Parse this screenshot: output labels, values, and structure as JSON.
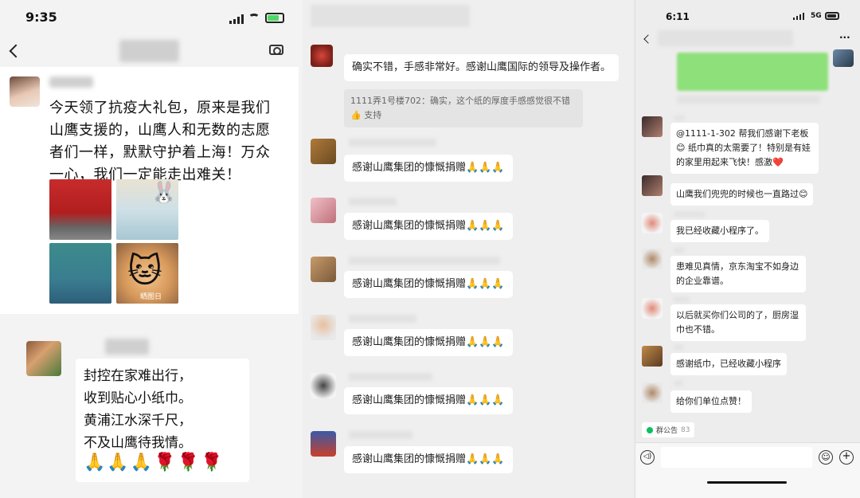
{
  "left": {
    "time": "9:35",
    "post_lines": [
      "今天领了抗疫大礼包，原来是我们",
      "山鹰支援的，山鹰人和无数的志愿",
      "者们一样，默默守护着上海！万众",
      "一心，我们一定能走出难关！"
    ],
    "photo_watermark": "晒图日",
    "handwritten_lines": [
      "封控在家难出行，",
      "收到贴心小纸巾。",
      "黄浦江水深千尺，",
      "不及山鹰待我情。"
    ],
    "handwritten_emojis": "🙏🙏🙏🌹🌹🌹"
  },
  "middle": {
    "top_message": "确实不错，手感非常好。感谢山鹰国际的领导及操作者。",
    "quote_text": "1111弄1号楼702：确实，这个纸的厚度手感感觉很不错",
    "quote_reaction": "👍 支持",
    "thanks_message": "感谢山鹰集团的慷慨捐赠",
    "thanks_emojis": "🙏🙏🙏"
  },
  "right": {
    "time": "6:11",
    "network": "5G",
    "more_icon": "···",
    "messages": [
      "@1111-1-302 帮我们感谢下老板😊 纸巾真的太需要了！特别是有娃的家里用起来飞快！感激❤️",
      "山鹰我们兜兜的时候也一直路过😊",
      "我已经收藏小程序了。",
      "患难见真情，京东淘宝不如身边的企业靠谱。",
      "以后就买你们公司的了，厨房湿巾也不错。",
      "感谢纸巾，已经收藏小程序",
      "给你们单位点赞！"
    ],
    "group_notice": "群公告",
    "group_notice_count": "83"
  },
  "colors": {
    "wechat_green": "#07c160",
    "blurred_green": "#8ee07a",
    "bubble_bg": "#ffffff",
    "panel_bg": "#ededed"
  }
}
